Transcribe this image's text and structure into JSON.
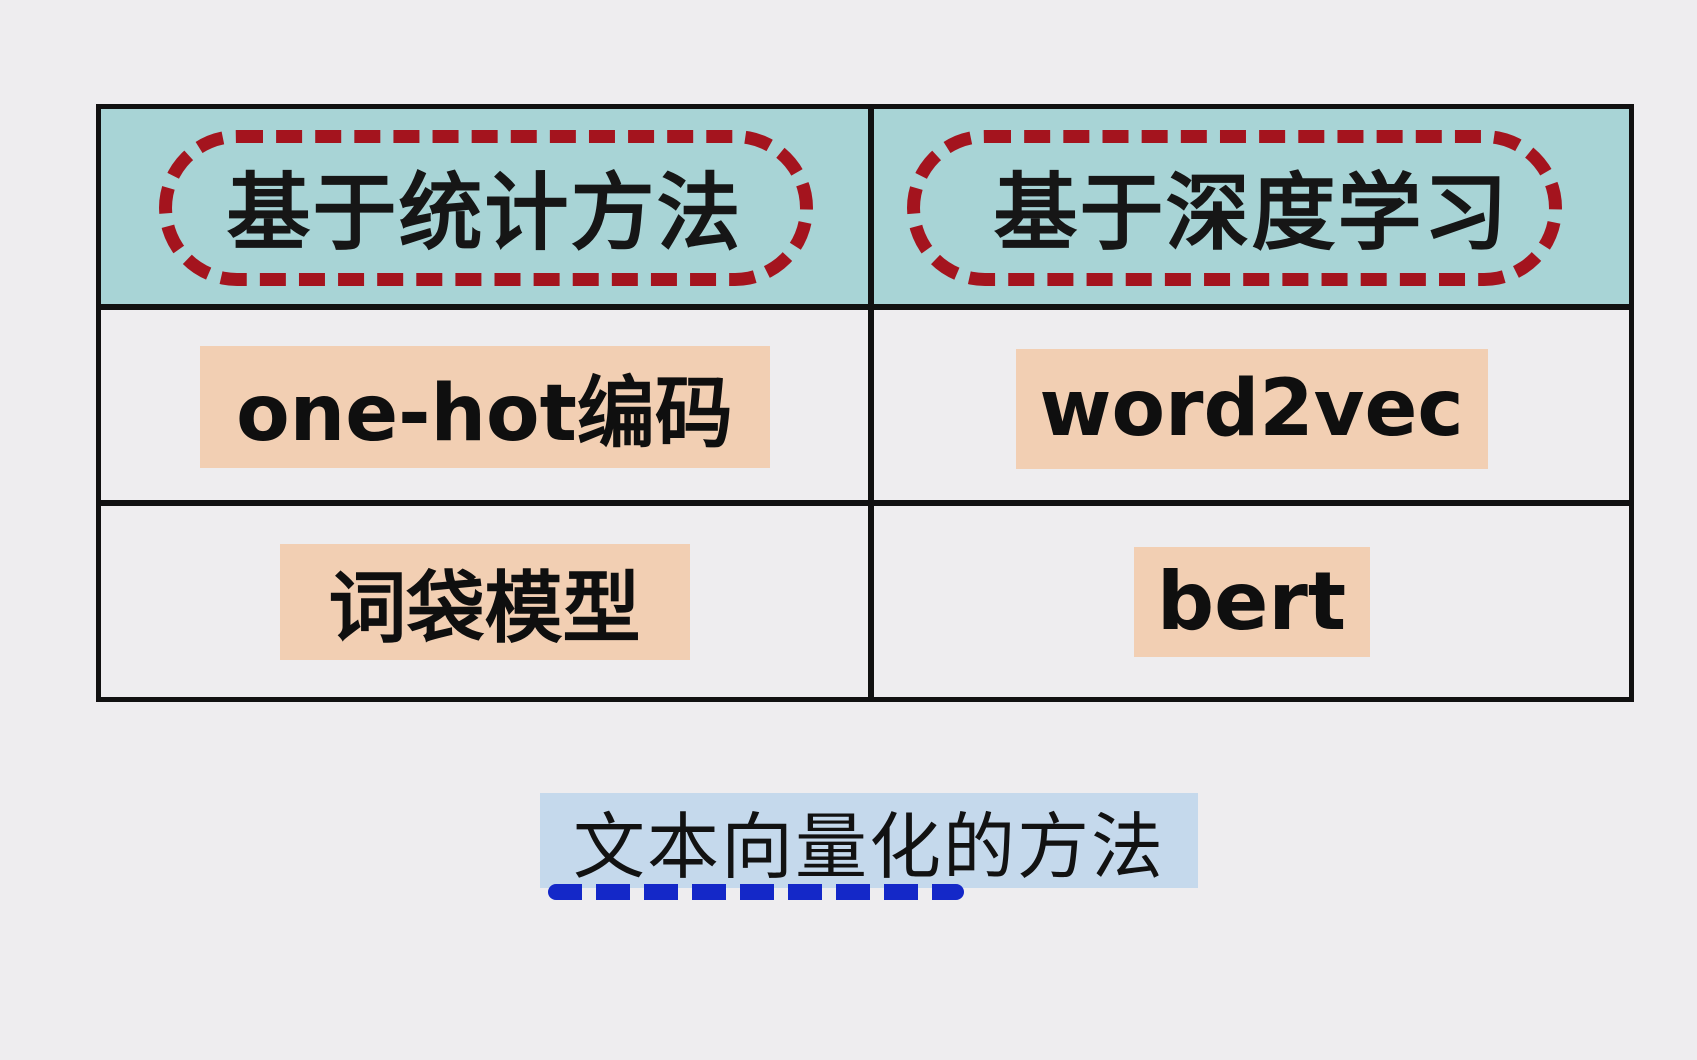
{
  "table": {
    "header": {
      "left": "基于统计方法",
      "right": "基于深度学习"
    },
    "rows": [
      {
        "left": "one-hot编码",
        "right": "word2vec"
      },
      {
        "left": "词袋模型",
        "right": "bert"
      }
    ]
  },
  "caption": {
    "text": "文本向量化的方法"
  },
  "colors": {
    "background": "#eeedef",
    "header_fill": "#a8d4d6",
    "tag_fill": "#f2cfb3",
    "oval_dash": "#a4141e",
    "caption_fill": "#c5d9ec",
    "underline": "#1428c8"
  }
}
